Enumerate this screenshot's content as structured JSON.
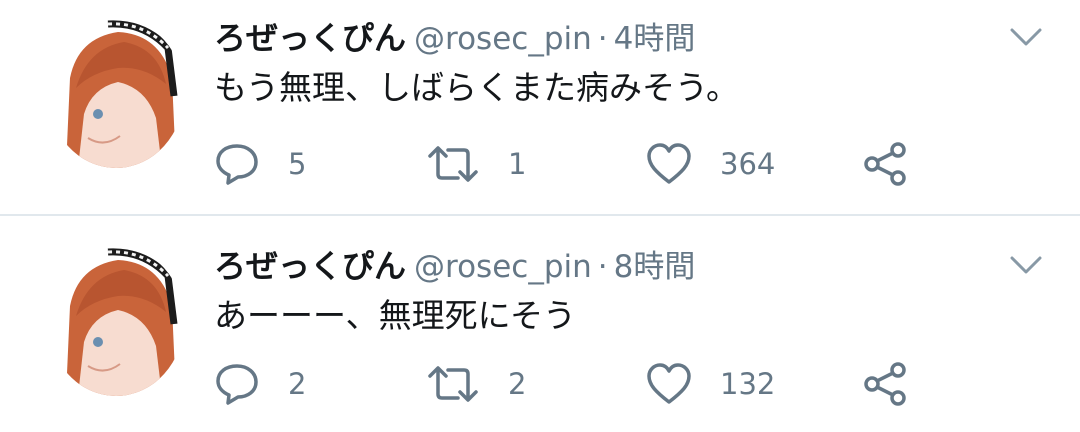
{
  "timeline": {
    "tweets": [
      {
        "author": "ろぜっくぴん",
        "handle": "@rosec_pin",
        "separator": "·",
        "time": "4時間",
        "text": "もう無理、しばらくまた病みそう。",
        "replies": "5",
        "retweets": "1",
        "likes": "364"
      },
      {
        "author": "ろぜっくぴん",
        "handle": "@rosec_pin",
        "separator": "·",
        "time": "8時間",
        "text": "あーーー、無理死にそう",
        "replies": "2",
        "retweets": "2",
        "likes": "132"
      }
    ]
  },
  "icons": {
    "reply": "reply-icon",
    "retweet": "retweet-icon",
    "like": "like-icon",
    "share": "share-icon",
    "menu": "chevron-down-icon",
    "avatar": "avatar"
  },
  "colors": {
    "text_primary": "#14171a",
    "text_secondary": "#657786",
    "divider": "#e1e8ed"
  }
}
